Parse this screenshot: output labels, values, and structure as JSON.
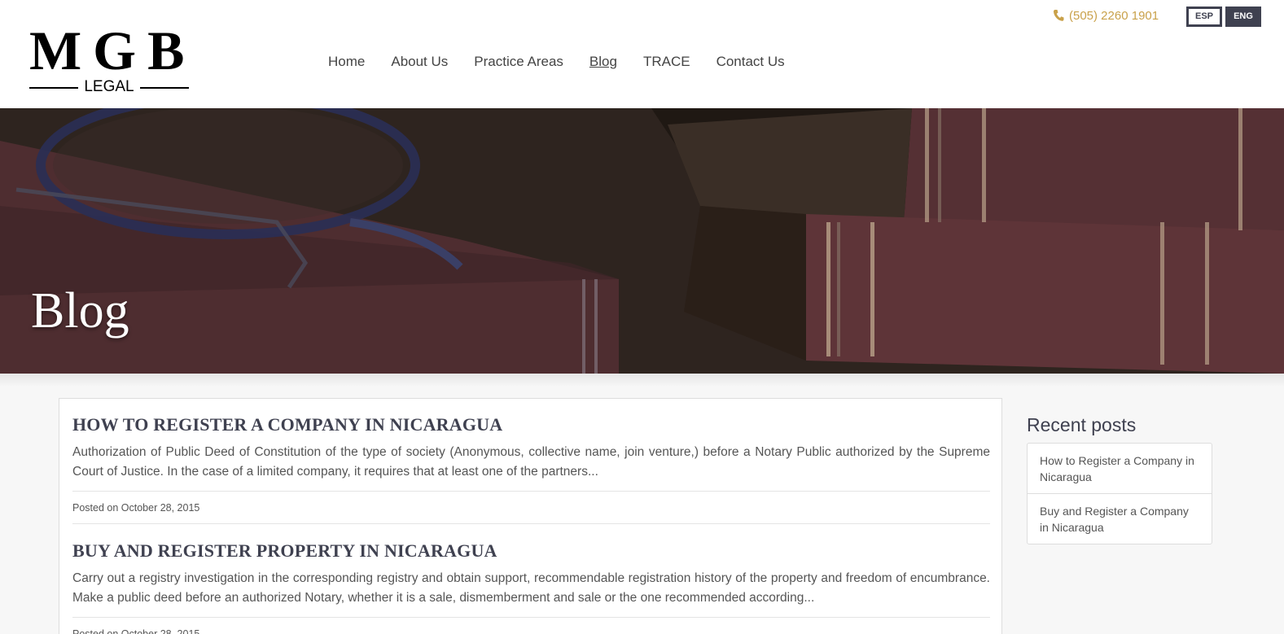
{
  "brand": {
    "logo_main": "MGB",
    "logo_sub": "LEGAL"
  },
  "nav": {
    "items": [
      {
        "label": "Home"
      },
      {
        "label": "About Us"
      },
      {
        "label": "Practice Areas"
      },
      {
        "label": "Blog",
        "active": true
      },
      {
        "label": "TRACE"
      },
      {
        "label": "Contact Us"
      }
    ]
  },
  "topbar": {
    "phone": "(505) 2260 1901",
    "phone_icon": "phone-icon",
    "lang_esp": "ESP",
    "lang_eng": "ENG"
  },
  "hero": {
    "title": "Blog"
  },
  "posts": [
    {
      "title": "HOW TO REGISTER A COMPANY IN NICARAGUA",
      "excerpt": "Authorization of Public Deed of Constitution of the type of society (Anonymous, collective name, join venture,) before a Notary Public authorized by the Supreme Court of Justice. In the case of a limited company, it requires that at least one of the partners...",
      "posted": "Posted on October 28, 2015"
    },
    {
      "title": "BUY AND REGISTER PROPERTY IN NICARAGUA",
      "excerpt": "Carry out a registry investigation in the corresponding registry and obtain support, recommendable registration history of the property and freedom of encumbrance. Make a public deed before an authorized Notary, whether it is a sale, dismemberment and sale or the one recommended according...",
      "posted": "Posted on October 28, 2015"
    }
  ],
  "sidebar": {
    "recent_title": "Recent posts",
    "recent": [
      {
        "label": "How to Register a Company in Nicaragua"
      },
      {
        "label": "Buy and Register a Company in Nicaragua"
      }
    ]
  },
  "colors": {
    "accent": "#c9a14a",
    "dark": "#3f4150"
  }
}
